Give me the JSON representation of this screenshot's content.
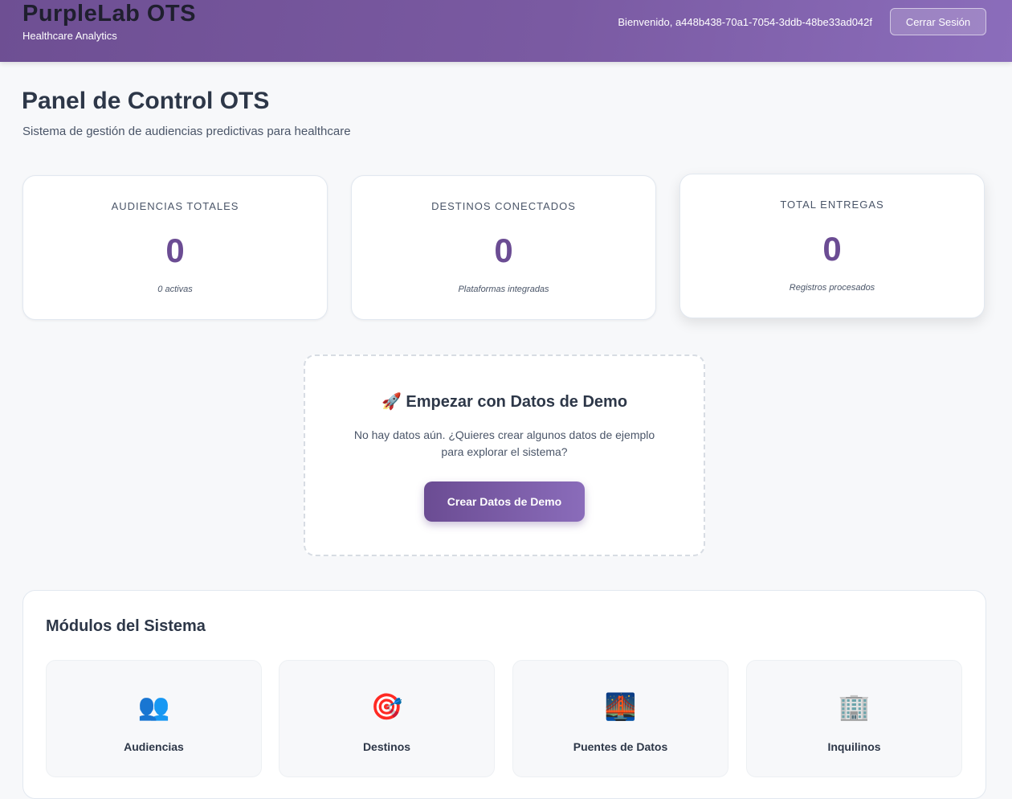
{
  "header": {
    "brand_title": "PurpleLab OTS",
    "brand_subtitle": "Healthcare Analytics",
    "welcome_text": "Bienvenido, a448b438-70a1-7054-3ddb-48be33ad042f",
    "logout_label": "Cerrar Sesión"
  },
  "page": {
    "title": "Panel de Control OTS",
    "subtitle": "Sistema de gestión de audiencias predictivas para healthcare"
  },
  "stats": [
    {
      "label": "AUDIENCIAS TOTALES",
      "value": "0",
      "note": "0 activas"
    },
    {
      "label": "DESTINOS CONECTADOS",
      "value": "0",
      "note": "Plataformas integradas"
    },
    {
      "label": "TOTAL ENTREGAS",
      "value": "0",
      "note": "Registros procesados"
    }
  ],
  "demo": {
    "icon": "rocket-icon",
    "title": "🚀 Empezar con Datos de Demo",
    "text": "No hay datos aún. ¿Quieres crear algunos datos de ejemplo para explorar el sistema?",
    "button_label": "Crear Datos de Demo"
  },
  "modules": {
    "title": "Módulos del Sistema",
    "items": [
      {
        "label": "Audiencias",
        "icon": "👥",
        "icon_name": "people-icon"
      },
      {
        "label": "Destinos",
        "icon": "🎯",
        "icon_name": "target-icon"
      },
      {
        "label": "Puentes de Datos",
        "icon": "🌉",
        "icon_name": "bridge-icon"
      },
      {
        "label": "Inquilinos",
        "icon": "🏢",
        "icon_name": "building-icon"
      }
    ]
  },
  "colors": {
    "accent": "#6b4c93",
    "header_gradient_start": "#6e4f93",
    "header_gradient_end": "#8b6dbb"
  }
}
